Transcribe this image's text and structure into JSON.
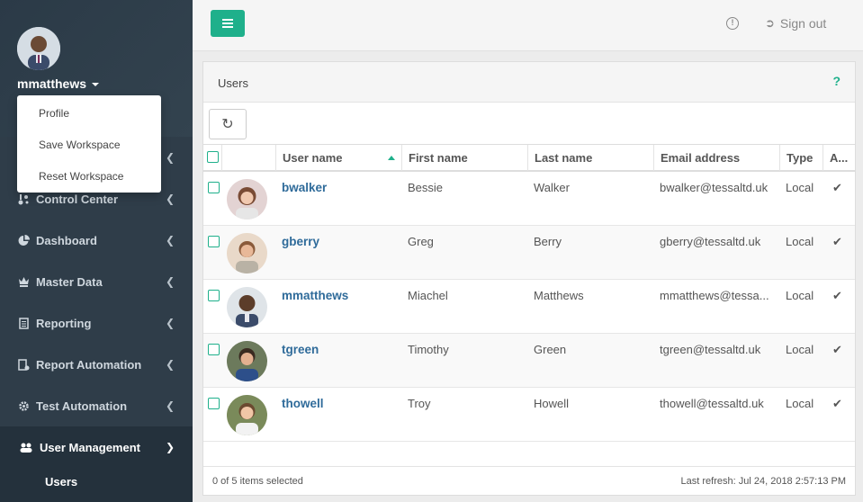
{
  "sidebar": {
    "username": "mmatthews",
    "user_menu": [
      "Profile",
      "Save Workspace",
      "Reset Workspace"
    ],
    "items": [
      {
        "label": "Control Center",
        "icon": "control-center-icon"
      },
      {
        "label": "Dashboard",
        "icon": "pie-chart-icon"
      },
      {
        "label": "Master Data",
        "icon": "crown-icon"
      },
      {
        "label": "Reporting",
        "icon": "document-icon"
      },
      {
        "label": "Report Automation",
        "icon": "report-automation-icon"
      },
      {
        "label": "Test Automation",
        "icon": "gear-icon"
      },
      {
        "label": "User Management",
        "icon": "users-icon"
      }
    ],
    "sub_item": "Users"
  },
  "topbar": {
    "sign_out": "Sign out"
  },
  "panel": {
    "title": "Users",
    "help": "?",
    "columns": [
      "User name",
      "First name",
      "Last name",
      "Email address",
      "Type",
      "A..."
    ],
    "rows": [
      {
        "username": "bwalker",
        "first": "Bessie",
        "last": "Walker",
        "email": "bwalker@tessaltd.uk",
        "type": "Local"
      },
      {
        "username": "gberry",
        "first": "Greg",
        "last": "Berry",
        "email": "gberry@tessaltd.uk",
        "type": "Local"
      },
      {
        "username": "mmatthews",
        "first": "Miachel",
        "last": "Matthews",
        "email": "mmatthews@tessa...",
        "type": "Local"
      },
      {
        "username": "tgreen",
        "first": "Timothy",
        "last": "Green",
        "email": "tgreen@tessaltd.uk",
        "type": "Local"
      },
      {
        "username": "thowell",
        "first": "Troy",
        "last": "Howell",
        "email": "thowell@tessaltd.uk",
        "type": "Local"
      }
    ],
    "footer_left": "0 of 5 items selected",
    "footer_right": "Last refresh: Jul 24, 2018 2:57:13 PM"
  },
  "colors": {
    "accent": "#1fb08b",
    "sidebar_bg": "#2f3d49",
    "link": "#2f6b9a"
  }
}
